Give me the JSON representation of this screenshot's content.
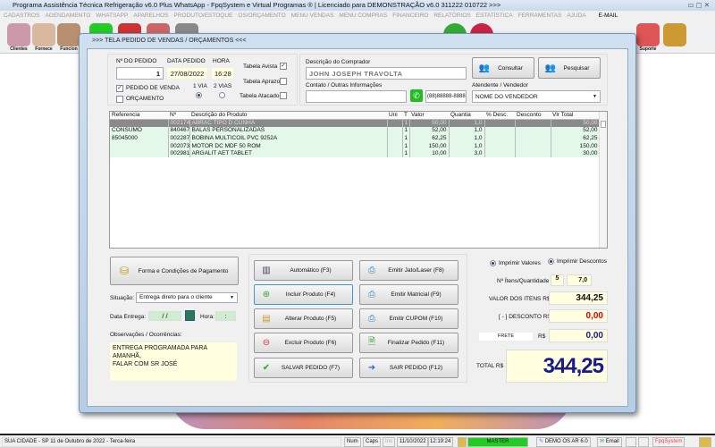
{
  "app": {
    "title": "Programa Assistência Técnica Refrigeração v6.0 Plus WhatsApp - FpqSystem e Virtual Programas ® | Licenciado para  DEMONSTRAÇÃO v6.0 311222 010722 >>>"
  },
  "menu": [
    "CADASTROS",
    "AGENDAMENTO",
    "WHATSAPP",
    "APARELHOS",
    "PRODUTO/ESTOQUE",
    "OS/ORÇAMENTO",
    "MENU VENDAS",
    "MENU COMPRAS",
    "FINANCEIRO",
    "RELATÓRIOS",
    "ESTATÍSTICA",
    "FERRAMENTAS",
    "AJUDA",
    "E-MAIL"
  ],
  "toolbar": {
    "clientes": "Clientes",
    "fornece": "Fornece",
    "funcion": "Funcion",
    "suporte": "Suporte"
  },
  "modal": {
    "title": ">>>  TELA PEDIDO DE VENDAS / ORÇAMENTOS  <<<"
  },
  "order": {
    "num_label": "Nº DO PEDIDO",
    "num": "1",
    "date_label": "DATA PEDIDO",
    "date": "27/08/2022",
    "time_label": "HORA",
    "time": "16:28",
    "pedido_venda": "PEDIDO DE VENDA",
    "orcamento": "ORÇAMENTO",
    "via1": "1 VIA",
    "via2": "2 VIAS",
    "tabela_avista": "Tabela Avista",
    "tabela_aprazo": "Tabela Aprazo",
    "tabela_atacado": "Tabela Atacado"
  },
  "buyer": {
    "label": "Descrição do Comprador",
    "name": "JOHN JOSEPH TRAVOLTA",
    "consultar": "Consultar",
    "pesquisar": "Pesquisar",
    "contact_label": "Contato / Outras Informações",
    "contact": "",
    "phone": "(88)88888-8888",
    "seller_label": "Atendente / Vendedor",
    "seller": "NOME DO VENDEDOR"
  },
  "grid": {
    "columns": [
      "Referencia",
      "Nº",
      "Descrição do Produto",
      "Uni",
      "T",
      "Valor",
      "Quantia",
      "% Desc.",
      "Desconto",
      "Vlr Total"
    ],
    "rows": [
      [
        "",
        "002174",
        "ABRAC TIPO D CUNHA",
        "",
        "1",
        "50,00",
        "1,0",
        "",
        "",
        "50,00"
      ],
      [
        "CONSUMO",
        "840467",
        "BALAS PERSONALIZADAS",
        "",
        "1",
        "52,00",
        "1,0",
        "",
        "",
        "52,00"
      ],
      [
        "85045000",
        "002287",
        "BOBINA MULTICOIL PVC 9252A",
        "",
        "1",
        "62,25",
        "1,0",
        "",
        "",
        "62,25"
      ],
      [
        "",
        "002073",
        "MOTOR DC MDF 50 ROM",
        "",
        "1",
        "150,00",
        "1,0",
        "",
        "",
        "150,00"
      ],
      [
        "",
        "002981",
        "ARGALIT AET TABLET",
        "",
        "1",
        "10,00",
        "3,0",
        "",
        "",
        "30,00"
      ]
    ]
  },
  "left": {
    "payment": "Forma e Condições de Pagamento",
    "situacao_label": "Situação:",
    "situacao": "Entrega direto para o cliente",
    "entrega_label": "Data Entrega:",
    "entrega": "/ /",
    "hora_label": "Hora:",
    "hora": ":",
    "obs_label": "Observações / Ocorrências:",
    "obs": "ENTREGA PROGRAMADA PARA AMANHÃ,\nFALAR COM SR JOSÉ"
  },
  "actions": {
    "auto": "Automático     (F3)",
    "incluir": "Incluir Produto  (F4)",
    "alterar": "Alterar Produto  (F5)",
    "excluir": "Excluir Produto  (F6)",
    "salvar": "SALVAR PEDIDO (F7)",
    "jato": "Emitir Jato/Laser (F8)",
    "matricial": "Emitir Matricial   (F9)",
    "cupom": "Emitir CUPOM   (F10)",
    "finalizar": "Finalizar Pedido  (F11)",
    "sair": "SAIR  PEDIDO  (F12)"
  },
  "totals": {
    "imprimir_valores": "Imprimir Valores",
    "imprimir_descontos": "Imprimir Descontos",
    "itens_label": "Nº Ítens/Quantidade",
    "itens": "5",
    "quantidade": "7,0",
    "valor_label": "VALOR DOS ITENS R$",
    "valor": "344,25",
    "desconto_label": "[ - ] DESCONTO R$",
    "desconto": "0,00",
    "frete_label": "FRETE",
    "rs": "R$",
    "frete": "0,00",
    "total_label": "TOTAL R$",
    "total": "344,25"
  },
  "status": {
    "city": "SUA CIDADE - SP 11 de Outubro de 2022 - Terca-feira",
    "num": "Num",
    "caps": "Caps",
    "ins": "Ins",
    "date": "11/10/2022",
    "time": "12:19:24",
    "user": "MASTER",
    "version": "DEMO OS AR 6.0",
    "email": "Email",
    "brand": "FpqSystem"
  },
  "colors": {
    "accent": "#1a1a8c",
    "red": "#e00000",
    "green": "#22cc22"
  }
}
